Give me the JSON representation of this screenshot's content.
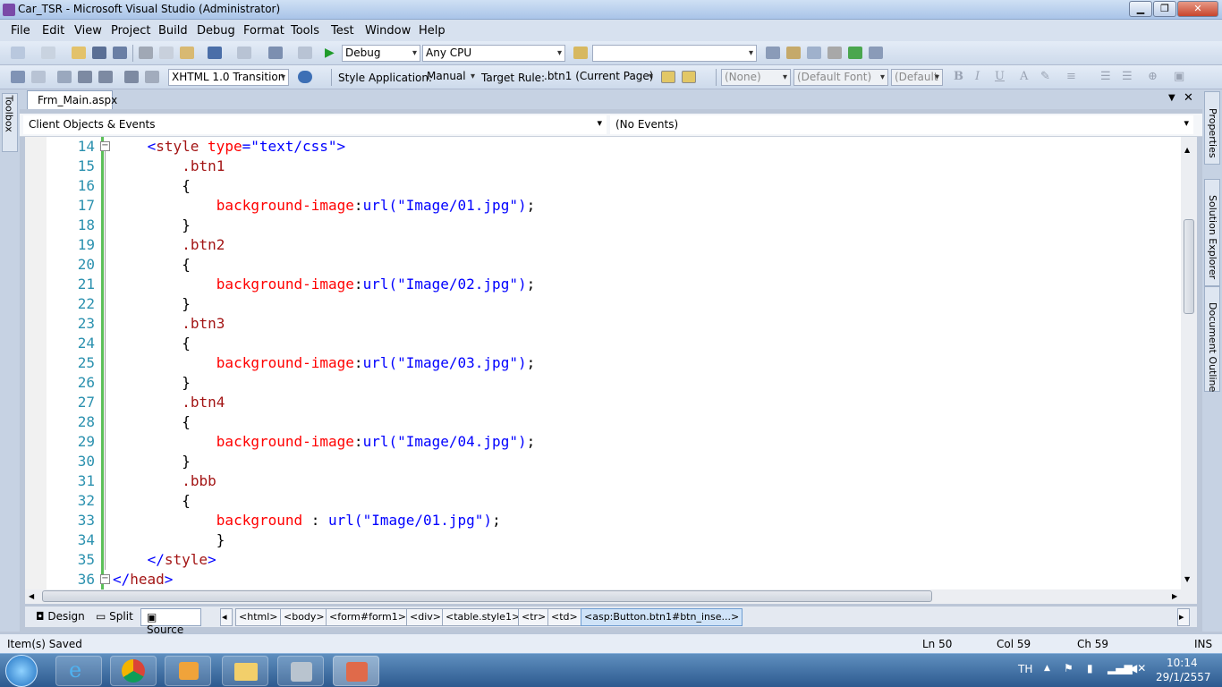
{
  "window": {
    "title": "Car_TSR - Microsoft Visual Studio (Administrator)"
  },
  "menu": [
    "File",
    "Edit",
    "View",
    "Project",
    "Build",
    "Debug",
    "Format",
    "Tools",
    "Test",
    "Window",
    "Help"
  ],
  "toolbar1": {
    "config": "Debug",
    "platform": "Any CPU",
    "search": ""
  },
  "toolbar2": {
    "doctype": "XHTML 1.0 Transition",
    "style_app_label": "Style Application:",
    "style_app_value": "Manual",
    "target_rule_label": "Target Rule:",
    "target_rule_value": ".btn1 (Current Page)",
    "block_format": "(None)",
    "font": "(Default Font)",
    "font_size": "(Default"
  },
  "side_tabs": {
    "left": "Toolbox",
    "right": [
      "Properties",
      "Solution Explorer",
      "Document Outline"
    ]
  },
  "document_tab": "Frm_Main.aspx",
  "nav": {
    "objects": "Client Objects & Events",
    "events": "(No Events)"
  },
  "code_lines": [
    {
      "n": "14",
      "parts": [
        {
          "t": "<",
          "c": "#0000ff"
        },
        {
          "t": "style",
          "c": "#a31515"
        },
        {
          "t": " ",
          "c": "#000"
        },
        {
          "t": "type",
          "c": "#ff0000"
        },
        {
          "t": "=",
          "c": "#0000ff"
        },
        {
          "t": "\"text/css\"",
          "c": "#0000ff"
        },
        {
          "t": ">",
          "c": "#0000ff"
        }
      ],
      "indent": 4
    },
    {
      "n": "15",
      "parts": [
        {
          "t": ".btn1",
          "c": "#a31515"
        }
      ],
      "indent": 8
    },
    {
      "n": "16",
      "parts": [
        {
          "t": "{",
          "c": "#000"
        }
      ],
      "indent": 8
    },
    {
      "n": "17",
      "parts": [
        {
          "t": "background-image",
          "c": "#ff0000"
        },
        {
          "t": ":",
          "c": "#000"
        },
        {
          "t": "url(\"Image/01.jpg\")",
          "c": "#0000ff"
        },
        {
          "t": ";",
          "c": "#000"
        }
      ],
      "indent": 12
    },
    {
      "n": "18",
      "parts": [
        {
          "t": "}",
          "c": "#000"
        }
      ],
      "indent": 8
    },
    {
      "n": "19",
      "parts": [
        {
          "t": ".btn2",
          "c": "#a31515"
        }
      ],
      "indent": 8
    },
    {
      "n": "20",
      "parts": [
        {
          "t": "{",
          "c": "#000"
        }
      ],
      "indent": 8
    },
    {
      "n": "21",
      "parts": [
        {
          "t": "background-image",
          "c": "#ff0000"
        },
        {
          "t": ":",
          "c": "#000"
        },
        {
          "t": "url(\"Image/02.jpg\")",
          "c": "#0000ff"
        },
        {
          "t": ";",
          "c": "#000"
        }
      ],
      "indent": 12
    },
    {
      "n": "22",
      "parts": [
        {
          "t": "}",
          "c": "#000"
        }
      ],
      "indent": 8
    },
    {
      "n": "23",
      "parts": [
        {
          "t": ".btn3",
          "c": "#a31515"
        }
      ],
      "indent": 8
    },
    {
      "n": "24",
      "parts": [
        {
          "t": "{",
          "c": "#000"
        }
      ],
      "indent": 8
    },
    {
      "n": "25",
      "parts": [
        {
          "t": "background-image",
          "c": "#ff0000"
        },
        {
          "t": ":",
          "c": "#000"
        },
        {
          "t": "url(\"Image/03.jpg\")",
          "c": "#0000ff"
        },
        {
          "t": ";",
          "c": "#000"
        }
      ],
      "indent": 12
    },
    {
      "n": "26",
      "parts": [
        {
          "t": "}",
          "c": "#000"
        }
      ],
      "indent": 8
    },
    {
      "n": "27",
      "parts": [
        {
          "t": ".btn4",
          "c": "#a31515"
        }
      ],
      "indent": 8
    },
    {
      "n": "28",
      "parts": [
        {
          "t": "{",
          "c": "#000"
        }
      ],
      "indent": 8
    },
    {
      "n": "29",
      "parts": [
        {
          "t": "background-image",
          "c": "#ff0000"
        },
        {
          "t": ":",
          "c": "#000"
        },
        {
          "t": "url(\"Image/04.jpg\")",
          "c": "#0000ff"
        },
        {
          "t": ";",
          "c": "#000"
        }
      ],
      "indent": 12
    },
    {
      "n": "30",
      "parts": [
        {
          "t": "}",
          "c": "#000"
        }
      ],
      "indent": 8
    },
    {
      "n": "31",
      "parts": [
        {
          "t": ".bbb",
          "c": "#a31515"
        }
      ],
      "indent": 8
    },
    {
      "n": "32",
      "parts": [
        {
          "t": "{",
          "c": "#000"
        }
      ],
      "indent": 8
    },
    {
      "n": "33",
      "parts": [
        {
          "t": "background ",
          "c": "#ff0000"
        },
        {
          "t": ": ",
          "c": "#000"
        },
        {
          "t": "url(\"Image/01.jpg\")",
          "c": "#0000ff"
        },
        {
          "t": ";",
          "c": "#000"
        }
      ],
      "indent": 12
    },
    {
      "n": "34",
      "parts": [
        {
          "t": "}",
          "c": "#000"
        }
      ],
      "indent": 12
    },
    {
      "n": "35",
      "parts": [
        {
          "t": "</",
          "c": "#0000ff"
        },
        {
          "t": "style",
          "c": "#a31515"
        },
        {
          "t": ">",
          "c": "#0000ff"
        }
      ],
      "indent": 4
    },
    {
      "n": "36",
      "parts": [
        {
          "t": "</",
          "c": "#0000ff"
        },
        {
          "t": "head",
          "c": "#a31515"
        },
        {
          "t": ">",
          "c": "#0000ff"
        }
      ],
      "indent": 0
    }
  ],
  "views": {
    "design": "Design",
    "split": "Split",
    "source": "Source"
  },
  "breadcrumbs": [
    "<html>",
    "<body>",
    "<form#form1>",
    "<div>",
    "<table.style1>",
    "<tr>",
    "<td>",
    "<asp:Button.btn1#btn_inse...>"
  ],
  "status": {
    "message": "Item(s) Saved",
    "ln": "Ln 50",
    "col": "Col 59",
    "ch": "Ch 59",
    "mode": "INS"
  },
  "taskbar": {
    "lang": "TH",
    "time": "10:14",
    "date": "29/1/2557"
  }
}
